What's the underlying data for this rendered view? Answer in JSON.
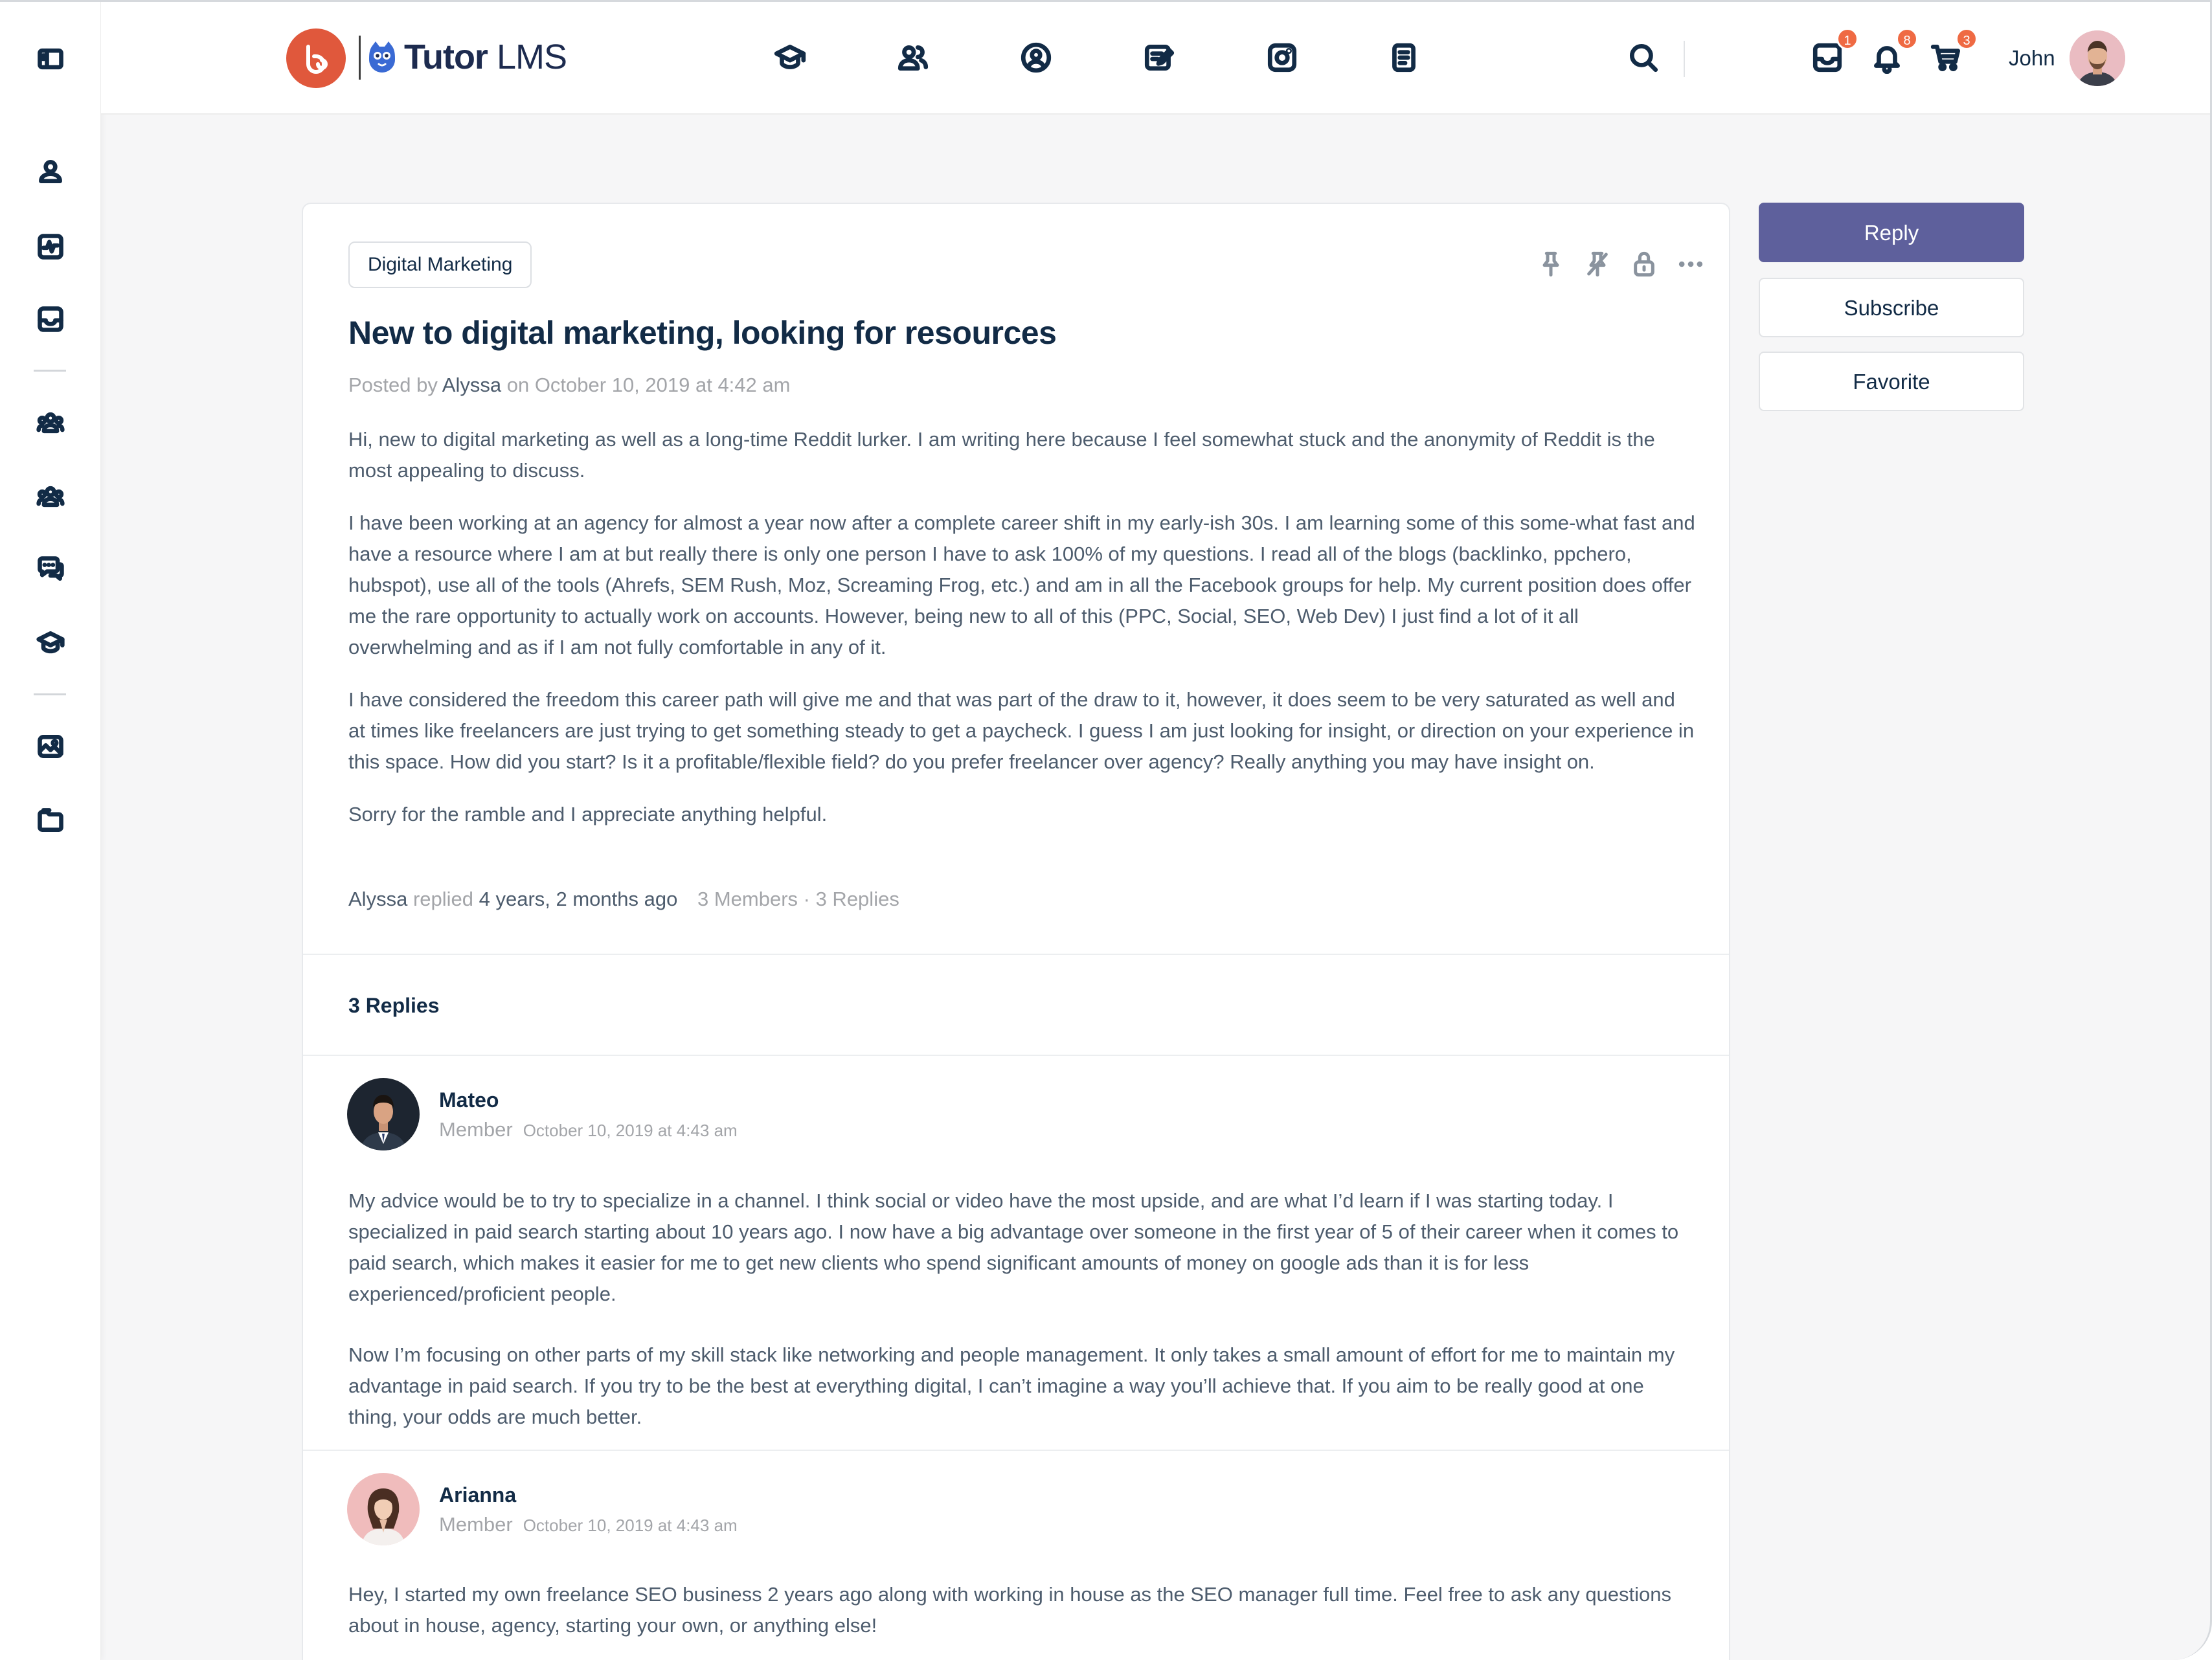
{
  "header": {
    "brand_name": "Tutor",
    "brand_suffix": "LMS",
    "user_name": "John",
    "badges": {
      "messages": "1",
      "notifications": "8",
      "cart": "3"
    },
    "nav_icons": [
      "courses-icon",
      "members-icon",
      "profile-icon",
      "blog-icon",
      "photos-icon",
      "documents-icon"
    ]
  },
  "sidebar": {
    "icons": [
      "panel-toggle-icon",
      "profile-icon",
      "activity-icon",
      "inbox-icon",
      "groups-icon",
      "members-icon",
      "forums-icon",
      "courses-icon",
      "photos-icon",
      "folder-icon"
    ]
  },
  "topic": {
    "tag": "Digital Marketing",
    "title": "New to digital marketing, looking for resources",
    "meta_prefix": "Posted by",
    "author": "Alyssa",
    "meta_on": "on October 10, 2019 at 4:42 am",
    "paragraphs": [
      "Hi, new to digital marketing as well as a long-time Reddit lurker. I am writing here because I feel somewhat stuck and the anonymity of Reddit is the most appealing to discuss.",
      "I have been working at an agency for almost a year now after a complete career shift in my early-ish 30s. I am learning some of this some-what fast and have a resource where I am at but really there is only one person I have to ask 100% of my questions. I read all of the blogs (backlinko, ppchero, hubspot), use all of the tools (Ahrefs, SEM Rush, Moz, Screaming Frog, etc.) and am in all the Facebook groups for help. My current position does offer me the rare opportunity to actually work on accounts. However, being new to all of this (PPC, Social, SEO, Web Dev) I just find a lot of it all overwhelming and as if I am not fully comfortable in any of it.",
      "I have considered the freedom this career path will give me and that was part of the draw to it, however, it does seem to be very saturated as well and at times like freelancers are just trying to get something steady to get a paycheck. I guess I am just looking for insight, or direction on your experience in this space. How did you start? Is it a profitable/flexible field? do you prefer freelancer over agency? Really anything you may have insight on.",
      "Sorry for the ramble and I appreciate anything helpful."
    ],
    "footer": {
      "last_user": "Alyssa",
      "replied_word": "replied",
      "ago": "4 years, 2 months ago",
      "stats": "3 Members · 3 Replies"
    }
  },
  "replies_heading": "3 Replies",
  "replies": [
    {
      "name": "Mateo",
      "role": "Member",
      "date": "October 10, 2019 at 4:43 am",
      "paragraphs": [
        "My advice would be to try to specialize in a channel. I think social or video have the most upside, and are what I’d learn if I was starting today. I specialized in paid search starting about 10 years ago. I now have a big advantage over someone in the first year of 5 of their career when it comes to paid search, which makes it easier for me to get new clients who spend significant amounts of money on google ads than it is for less experienced/proficient people.",
        "Now I’m focusing on other parts of my skill stack like networking and people management. It only takes a small amount of effort for me to maintain my advantage in paid search. If you try to be the best at everything digital, I can’t imagine a way you’ll achieve that. If you aim to be really good at one thing, your odds are much better."
      ]
    },
    {
      "name": "Arianna",
      "role": "Member",
      "date": "October 10, 2019 at 4:43 am",
      "paragraphs": [
        "Hey, I started my own freelance SEO business 2 years ago along with working in house as the SEO manager full time. Feel free to ask any questions about in house, agency, starting your own, or anything else!"
      ]
    }
  ],
  "actions": {
    "reply": "Reply",
    "subscribe": "Subscribe",
    "favorite": "Favorite"
  },
  "colors": {
    "primary_button": "#5e609c",
    "badge": "#ef6a43",
    "logo": "#e0583c",
    "text": "#122b46",
    "muted": "#a3a5a9"
  }
}
